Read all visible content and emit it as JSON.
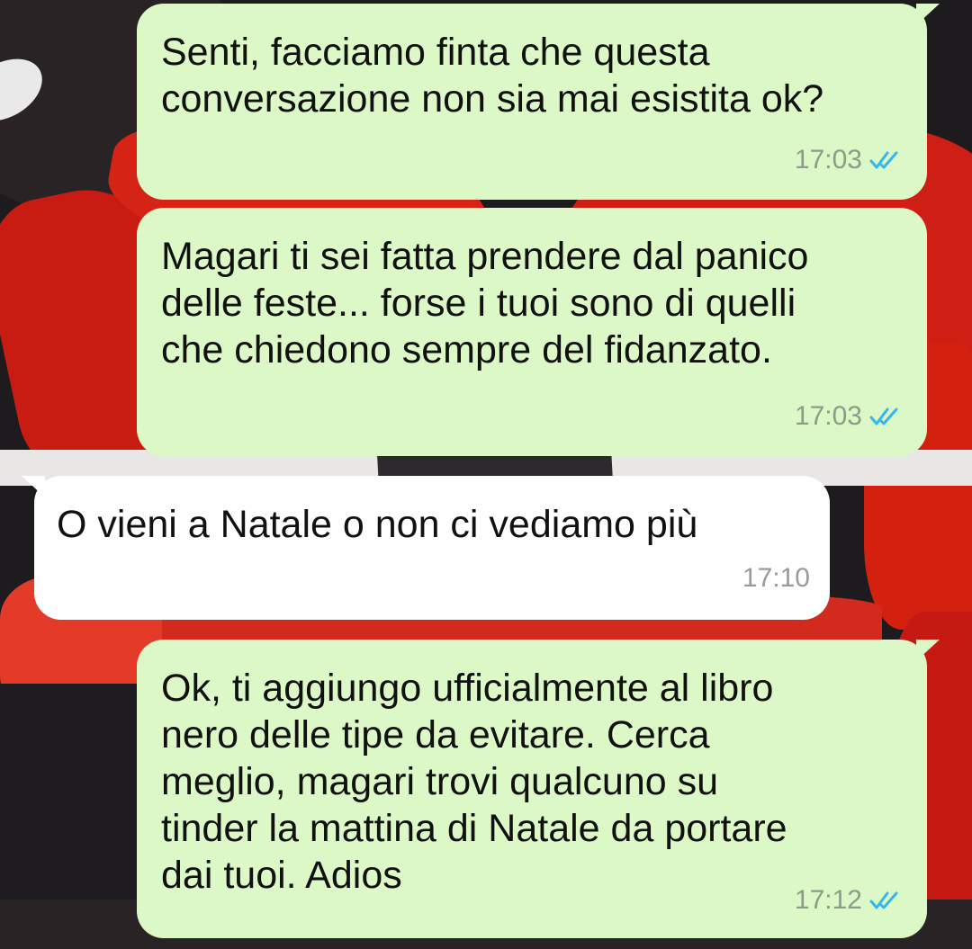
{
  "colors": {
    "outgoing_bubble": "#dcf8c6",
    "incoming_bubble": "#ffffff",
    "read_ticks": "#34b7f1"
  },
  "messages": [
    {
      "direction": "outgoing",
      "text": "Senti, facciamo finta che questa\nconversazione non sia mai esistita ok?",
      "time": "17:03",
      "status_icon": "double-check-read-icon"
    },
    {
      "direction": "outgoing",
      "text": "Magari ti sei fatta prendere dal panico\ndelle feste... forse i tuoi sono di quelli\nche chiedono sempre del fidanzato.",
      "time": "17:03",
      "status_icon": "double-check-read-icon"
    },
    {
      "direction": "incoming",
      "text": "O vieni a Natale o non ci vediamo più",
      "time": "17:10"
    },
    {
      "direction": "outgoing",
      "text": "Ok, ti aggiungo ufficialmente al libro\nnero delle tipe da evitare. Cerca\nmeglio, magari trovi qualcuno su\ntinder la mattina di Natale da portare\ndai tuoi. Adios",
      "time": "17:12",
      "status_icon": "double-check-read-icon"
    }
  ]
}
